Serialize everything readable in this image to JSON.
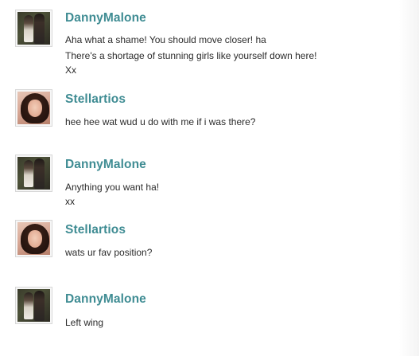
{
  "messages": [
    {
      "author": "DannyMalone",
      "avatar": "dannymalone-avatar",
      "lines": [
        "Aha what a shame! You should move closer! ha",
        "There's a shortage of stunning girls like yourself down here!",
        "Xx"
      ]
    },
    {
      "author": "Stellartios",
      "avatar": "stellartios-avatar",
      "lines": [
        "hee hee wat wud u do with me if i was there?"
      ]
    },
    {
      "author": "DannyMalone",
      "avatar": "dannymalone-avatar",
      "lines": [
        "Anything you want ha!",
        "xx"
      ]
    },
    {
      "author": "Stellartios",
      "avatar": "stellartios-avatar",
      "lines": [
        "wats ur fav position?"
      ]
    },
    {
      "author": "DannyMalone",
      "avatar": "dannymalone-avatar",
      "lines": [
        "Left wing"
      ]
    }
  ],
  "colors": {
    "name": "#3f8c93",
    "text": "#2b2b2b",
    "background": "#ffffff"
  }
}
